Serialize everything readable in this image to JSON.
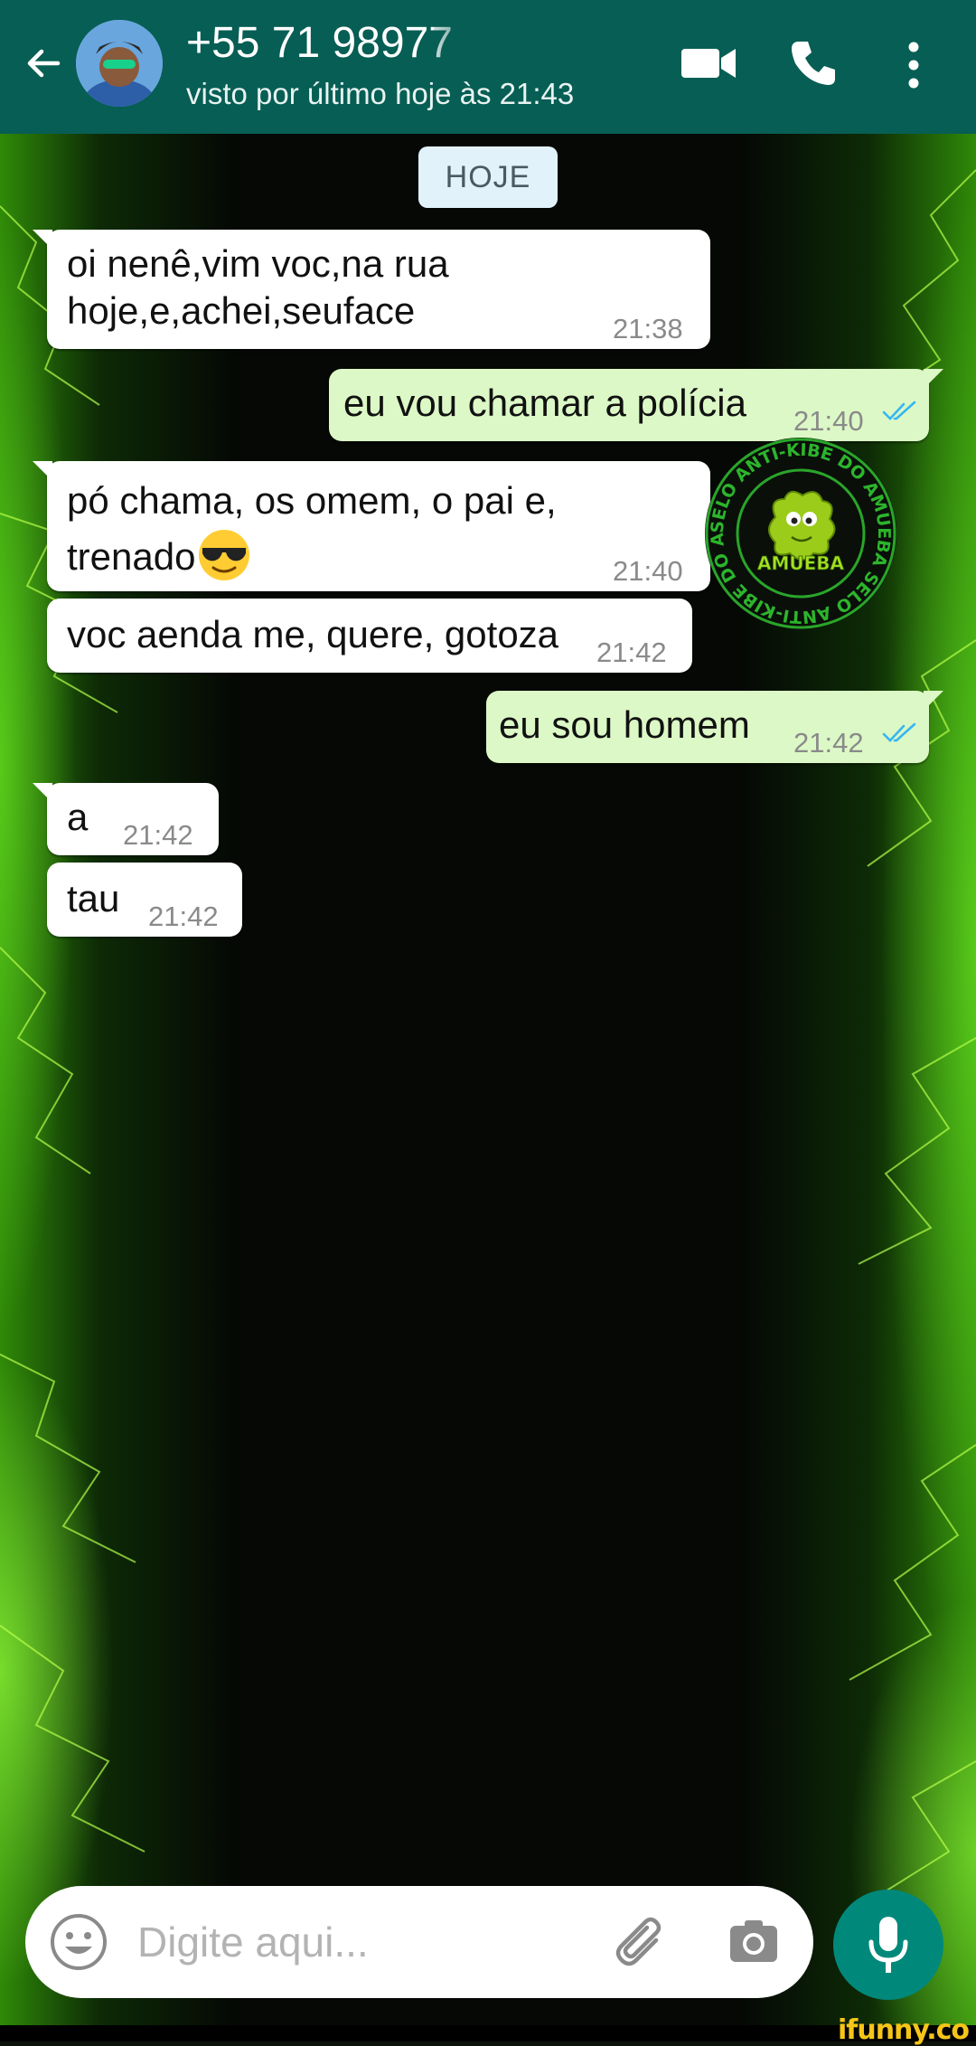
{
  "header": {
    "contact_name": "+55 71 98977",
    "status": "visto por último hoje às 21:43"
  },
  "date_chip": "HOJE",
  "messages": [
    {
      "direction": "incoming",
      "line1": "oi nenê,vim voc,na rua",
      "line2": "hoje,e,achei,seuface",
      "time": "21:38"
    },
    {
      "direction": "outgoing",
      "line1": "eu vou chamar a polícia",
      "time": "21:40",
      "read": true
    },
    {
      "direction": "incoming",
      "line1": "pó chama, os omem, o pai e,",
      "line2": "trenado",
      "emoji": "sunglasses-emoji",
      "time": "21:40"
    },
    {
      "direction": "incoming",
      "line1": "voc aenda me, quere, gotoza",
      "time": "21:42"
    },
    {
      "direction": "outgoing",
      "line1": "eu sou homem",
      "time": "21:42",
      "read": true
    },
    {
      "direction": "incoming",
      "line1": "a",
      "time": "21:42"
    },
    {
      "direction": "incoming",
      "line1": "tau",
      "time": "21:42"
    }
  ],
  "stamp": {
    "ring_text": "SELO ANTI-KIBE DO AMUEBA SELO ANTI-KIBE DO AMUEBA",
    "center_text": "AMUEBA"
  },
  "composer": {
    "placeholder": "Digite aqui..."
  },
  "watermark": "ifunny.co",
  "colors": {
    "header": "#075e54",
    "incoming_bubble": "#ffffff",
    "outgoing_bubble": "#dcf8c6",
    "read_ticks": "#34b7f1",
    "mic_button": "#00897b"
  }
}
